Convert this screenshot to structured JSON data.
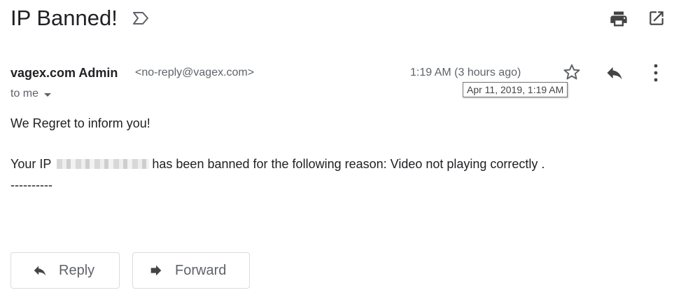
{
  "header": {
    "subject": "IP Banned!",
    "icons": [
      "label-important-icon",
      "print-icon",
      "open-new-window-icon"
    ]
  },
  "message": {
    "sender_name": "vagex.com Admin",
    "sender_email": "<no-reply@vagex.com>",
    "recipient_label": "to me",
    "date_text": "1:19 AM (3 hours ago)",
    "date_tooltip": "Apr 11, 2019, 1:19 AM",
    "icons": [
      "star-icon",
      "reply-icon",
      "more-vert-icon"
    ]
  },
  "body": {
    "line1": "We Regret to inform you!",
    "line2_prefix": "Your IP",
    "line2_suffix": "has been banned for the following reason: Video not playing correctly .",
    "separator": "----------"
  },
  "actions": {
    "reply_label": "Reply",
    "forward_label": "Forward"
  },
  "colors": {
    "text_primary": "#202124",
    "text_secondary": "#5f6368",
    "button_border": "#dadce0"
  }
}
